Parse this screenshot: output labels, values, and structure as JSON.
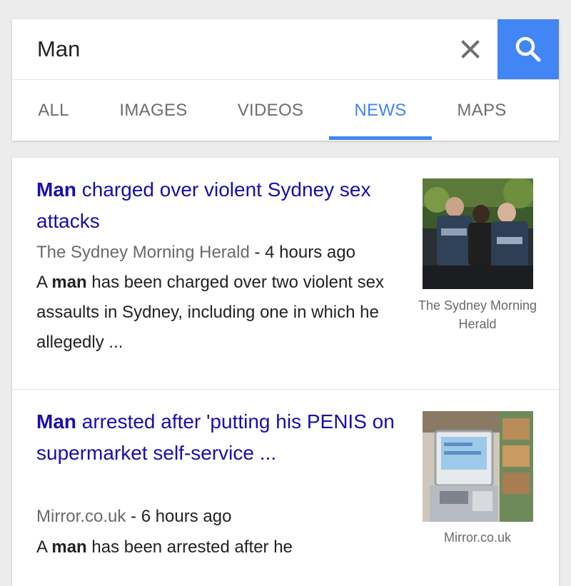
{
  "search": {
    "query": "Man",
    "clear_icon": "close-icon",
    "search_icon": "search-icon",
    "accent": "#4285f4"
  },
  "tabs": [
    {
      "label": "ALL",
      "active": false
    },
    {
      "label": "IMAGES",
      "active": false
    },
    {
      "label": "VIDEOS",
      "active": false
    },
    {
      "label": "NEWS",
      "active": true
    },
    {
      "label": "MAPS",
      "active": false
    }
  ],
  "results": [
    {
      "title_bold": "Man",
      "title_rest": " charged over violent Sydney sex attacks",
      "source": "The Sydney Morning Herald",
      "separator": " - ",
      "time": "4 hours ago",
      "snippet_pre": "A ",
      "snippet_bold": "man",
      "snippet_post": " has been charged over two violent sex assaults in Sydney, including one in which he allegedly ...",
      "thumb_caption": "The Sydney Morning Herald"
    },
    {
      "title_bold": "Man",
      "title_rest": " arrested after 'putting his PENIS on supermarket self-service ...",
      "source": "Mirror.co.uk",
      "separator": " - ",
      "time": "6 hours ago",
      "snippet_pre": "A ",
      "snippet_bold": "man",
      "snippet_post": " has been arrested after he",
      "thumb_caption": "Mirror.co.uk"
    }
  ]
}
